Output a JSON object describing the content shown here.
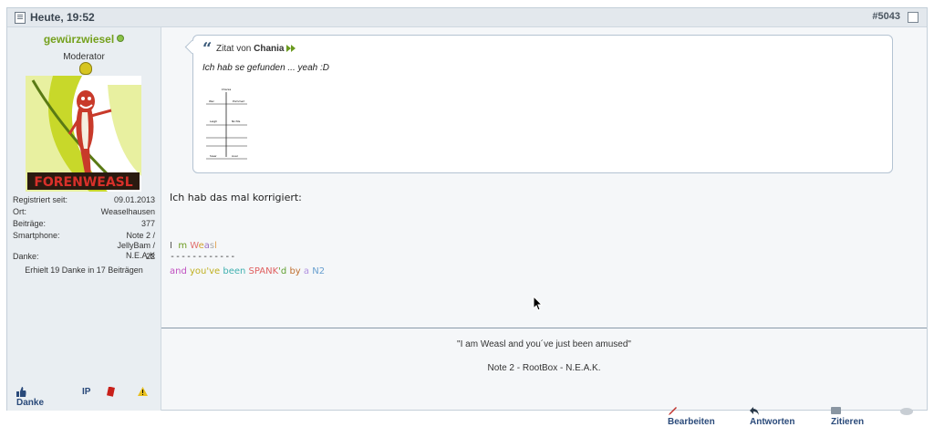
{
  "post": {
    "date": "Heute, 19:52",
    "number": "#5043",
    "author": {
      "username": "gewürzwiesel",
      "rank": "Moderator",
      "avatar_label": "FORENWEASL",
      "info": [
        {
          "key": "Registriert seit:",
          "value": "09.01.2013"
        },
        {
          "key": "Ort:",
          "value": "Weaselhausen"
        },
        {
          "key": "Beiträge:",
          "value": "377"
        },
        {
          "key": "Smartphone:",
          "value": "Note 2 / JellyBam / N.E.A.K"
        },
        {
          "key": "Danke:",
          "value": "22"
        }
      ],
      "thanks_summary": "Erhielt 19 Danke in 17 Beiträgen"
    },
    "quote": {
      "prefix": "Zitat von",
      "author": "Chania",
      "text": "Ich hab se gefunden ... yeah :D",
      "image_labels": [
        "Chania",
        "Wer",
        "Pommerl",
        "Leigh",
        "Nichts",
        "Sieer",
        "Auer"
      ]
    },
    "body": "Ich hab das mal korrigiert:",
    "signature": {
      "line1_parts": [
        {
          "t": "I",
          "c": "#555555"
        },
        {
          "t": "  ",
          "c": "#555555"
        },
        {
          "t": "m",
          "c": "#6a9a1e"
        },
        {
          "t": " ",
          "c": "#555555"
        },
        {
          "t": "W",
          "c": "#e07070"
        },
        {
          "t": "e",
          "c": "#d0a030"
        },
        {
          "t": "a",
          "c": "#9a70c0"
        },
        {
          "t": "s",
          "c": "#aaaaaa"
        },
        {
          "t": "l",
          "c": "#e0a050"
        }
      ],
      "dashes": "------------",
      "line2_parts": [
        {
          "t": "and ",
          "c": "#c050c0"
        },
        {
          "t": "you've ",
          "c": "#c0b020"
        },
        {
          "t": "been ",
          "c": "#40b0b0"
        },
        {
          "t": "SPANK",
          "c": "#e06060"
        },
        {
          "t": "'d ",
          "c": "#60a030"
        },
        {
          "t": "by ",
          "c": "#c07030"
        },
        {
          "t": "a ",
          "c": "#b090e0"
        },
        {
          "t": "N2",
          "c": "#6aa0d0"
        }
      ],
      "quote": "\"I am Weasl and you´ve just been amused\"",
      "device": "Note 2 - RootBox - N.E.A.K."
    },
    "actions": {
      "thanks": "Danke",
      "ip": "IP",
      "edit": "Bearbeiten",
      "reply": "Antworten",
      "quote": "Zitieren"
    }
  }
}
